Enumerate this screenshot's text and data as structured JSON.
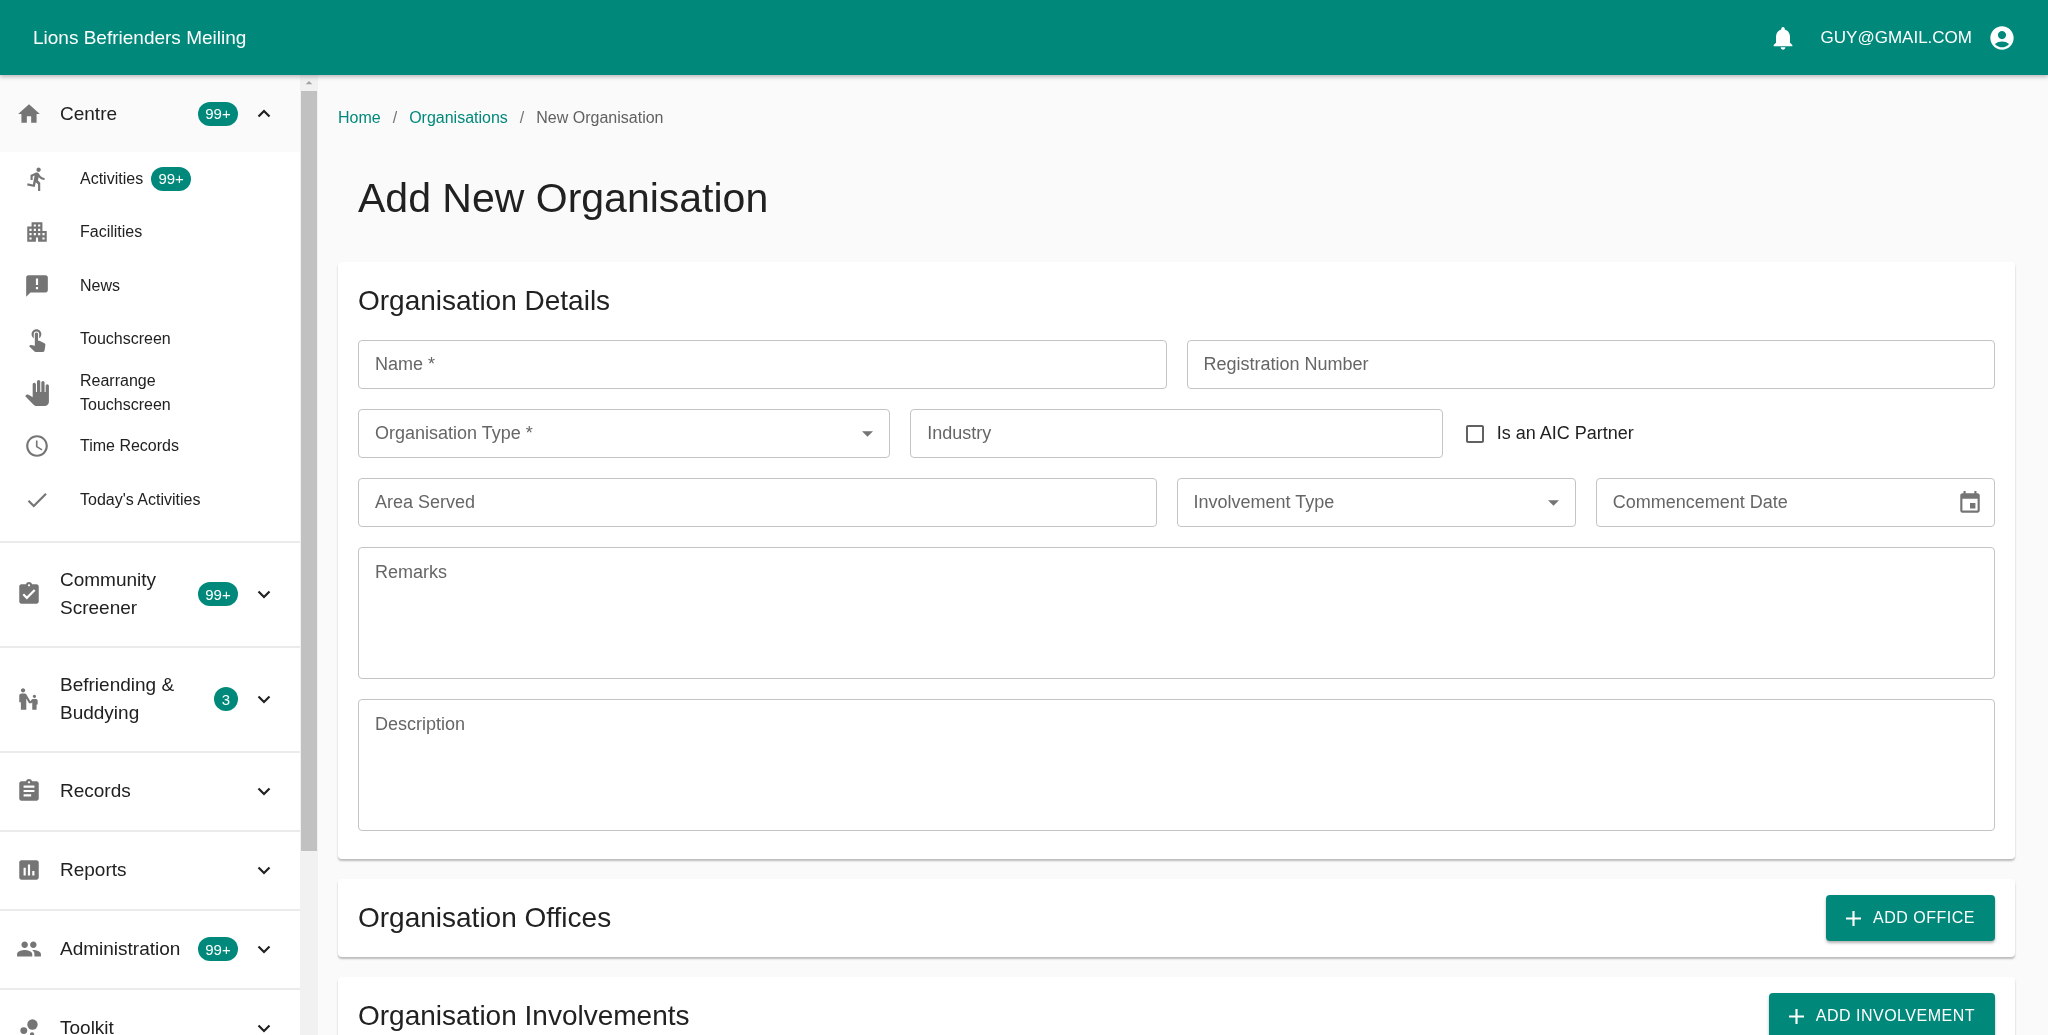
{
  "header": {
    "title": "Lions Befrienders Meiling",
    "user": "GUY@GMAIL.COM"
  },
  "sidebar": {
    "groups": [
      {
        "label": "Centre",
        "badge": "99+",
        "expanded": true,
        "children": [
          {
            "label": "Activities",
            "badge": "99+"
          },
          {
            "label": "Facilities"
          },
          {
            "label": "News"
          },
          {
            "label": "Touchscreen"
          },
          {
            "label": "Rearrange Touchscreen"
          },
          {
            "label": "Time Records"
          },
          {
            "label": "Today's Activities"
          }
        ]
      },
      {
        "label": "Community Screener",
        "badge": "99+",
        "expanded": false
      },
      {
        "label": "Befriending & Buddying",
        "badge": "3",
        "expanded": false
      },
      {
        "label": "Records",
        "expanded": false
      },
      {
        "label": "Reports",
        "expanded": false
      },
      {
        "label": "Administration",
        "badge": "99+",
        "expanded": false
      },
      {
        "label": "Toolkit",
        "expanded": false
      }
    ]
  },
  "breadcrumb": [
    {
      "label": "Home",
      "link": true
    },
    {
      "separator": "/",
      "label": "Organisations",
      "link": true
    },
    {
      "separator": "/",
      "label": "New Organisation",
      "link": false
    }
  ],
  "page_title": "Add New Organisation",
  "details": {
    "title": "Organisation Details",
    "rows": [
      [
        {
          "kind": "text",
          "placeholder": "Name *"
        },
        {
          "kind": "text",
          "placeholder": "Registration Number"
        }
      ],
      [
        {
          "kind": "select",
          "placeholder": "Organisation Type *"
        },
        {
          "kind": "text",
          "placeholder": "Industry"
        },
        {
          "kind": "checkbox",
          "label": "Is an AIC Partner",
          "checked": false
        }
      ],
      [
        {
          "kind": "text",
          "placeholder": "Area Served"
        },
        {
          "kind": "select",
          "placeholder": "Involvement Type"
        },
        {
          "kind": "date",
          "placeholder": "Commencement Date"
        }
      ],
      [
        {
          "kind": "textarea",
          "placeholder": "Remarks"
        }
      ],
      [
        {
          "kind": "textarea",
          "placeholder": "Description"
        }
      ]
    ]
  },
  "sections": [
    {
      "title": "Organisation Offices",
      "button": "ADD OFFICE"
    },
    {
      "title": "Organisation Involvements",
      "button": "ADD INVOLVEMENT"
    }
  ]
}
